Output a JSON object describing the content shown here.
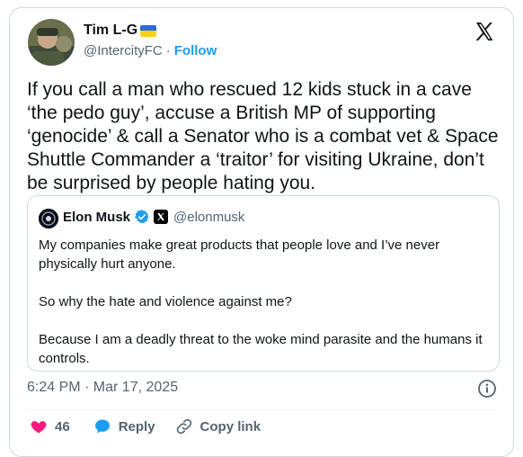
{
  "author": {
    "name": "Tim L-G",
    "handle": "@IntercityFC",
    "separator": "·",
    "follow_label": "Follow",
    "flag_colors": [
      "#2a6bd8",
      "#f7d117"
    ]
  },
  "tweet": {
    "text": "If you call a man who rescued 12 kids stuck in a cave ‘the pedo guy’, accuse a British MP of supporting ‘genocide’ & call a Senator who is a combat vet & Space Shuttle Commander a ‘traitor’ for visiting Ukraine, don’t be surprised by people hating you."
  },
  "quote": {
    "name": "Elon Musk",
    "handle": "@elonmusk",
    "text": "My companies make great products that people love and I’ve never physically hurt anyone.\n\nSo why the hate and violence against me?\n\nBecause I am a deadly threat to the woke mind parasite and the humans it controls."
  },
  "footer": {
    "timestamp": "6:24 PM · Mar 17, 2025",
    "likes": "46",
    "reply_label": "Reply",
    "copy_link_label": "Copy link"
  },
  "colors": {
    "accent": "#1d9bf0",
    "like": "#f91880",
    "muted": "#536471"
  },
  "icons": [
    "x-logo-icon",
    "verified-icon",
    "heart-icon",
    "reply-icon",
    "link-icon",
    "info-icon"
  ]
}
